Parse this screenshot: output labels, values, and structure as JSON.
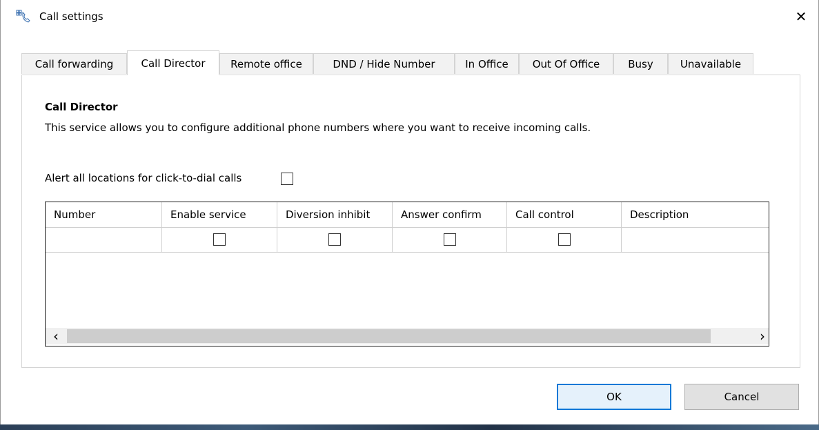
{
  "window": {
    "title": "Call settings",
    "close_glyph": "✕",
    "icon": "phone-settings-icon"
  },
  "tabs": [
    {
      "label": "Call forwarding"
    },
    {
      "label": "Call Director",
      "active": true
    },
    {
      "label": "Remote office"
    },
    {
      "label": "DND / Hide Number"
    },
    {
      "label": "In Office"
    },
    {
      "label": "Out Of Office"
    },
    {
      "label": "Busy"
    },
    {
      "label": "Unavailable"
    }
  ],
  "section": {
    "title": "Call Director",
    "description": "This service allows you to configure additional phone numbers where you want to receive incoming calls."
  },
  "alert_all": {
    "label": "Alert all locations for click-to-dial calls",
    "checked": false
  },
  "grid": {
    "columns": [
      "Number",
      "Enable service",
      "Diversion inhibit",
      "Answer confirm",
      "Call control",
      "Description"
    ],
    "rows": [
      {
        "number": "",
        "enable_service": false,
        "diversion_inhibit": false,
        "answer_confirm": false,
        "call_control": false,
        "description": ""
      }
    ],
    "scroll_left_glyph": "‹",
    "scroll_right_glyph": "›"
  },
  "buttons": {
    "ok": "OK",
    "cancel": "Cancel"
  },
  "colors": {
    "accent": "#0078d7",
    "tab_inactive": "#f2f2f2",
    "scroll_track": "#f0f0f0"
  }
}
